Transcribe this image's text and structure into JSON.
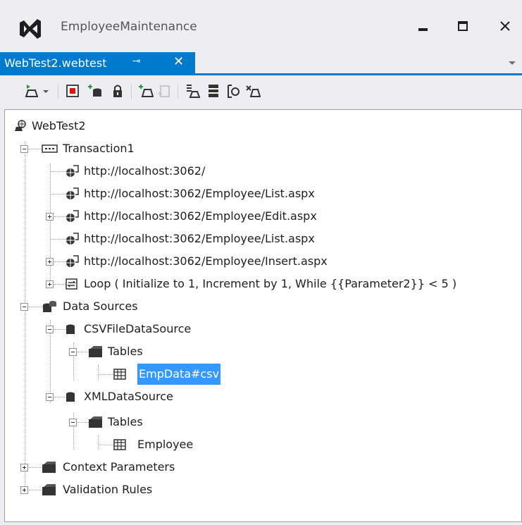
{
  "window": {
    "title": "EmployeeMaintenance",
    "accent": "#007acc"
  },
  "tab": {
    "label": "WebTest2.webtest",
    "pin_icon": "⊸",
    "close_icon": "✕"
  },
  "toolbar": {
    "buttons": [
      {
        "name": "run-test-icon"
      },
      {
        "name": "record-icon"
      },
      {
        "name": "add-data-source-icon"
      },
      {
        "name": "lock-icon"
      },
      {
        "name": "add-transaction-icon"
      },
      {
        "name": "add-request-icon"
      },
      {
        "name": "parameterize-icon"
      },
      {
        "name": "data-icon"
      },
      {
        "name": "context-icon"
      },
      {
        "name": "extract-icon"
      }
    ]
  },
  "tree": {
    "root": "WebTest2",
    "transaction": "Transaction1",
    "requests": [
      "http://localhost:3062/",
      "http://localhost:3062/Employee/List.aspx",
      "http://localhost:3062/Employee/Edit.aspx",
      "http://localhost:3062/Employee/List.aspx",
      "http://localhost:3062/Employee/Insert.aspx"
    ],
    "loop": "Loop ( Initialize to 1, Increment by 1, While {{Parameter2}} < 5 )",
    "data_sources": "Data Sources",
    "csv_source": "CSVFileDataSource",
    "csv_tables": "Tables",
    "csv_table": "EmpData#csv",
    "xml_source": "XMLDataSource",
    "xml_tables": "Tables",
    "xml_table": "Employee",
    "context_parameters": "Context Parameters",
    "validation_rules": "Validation Rules"
  }
}
